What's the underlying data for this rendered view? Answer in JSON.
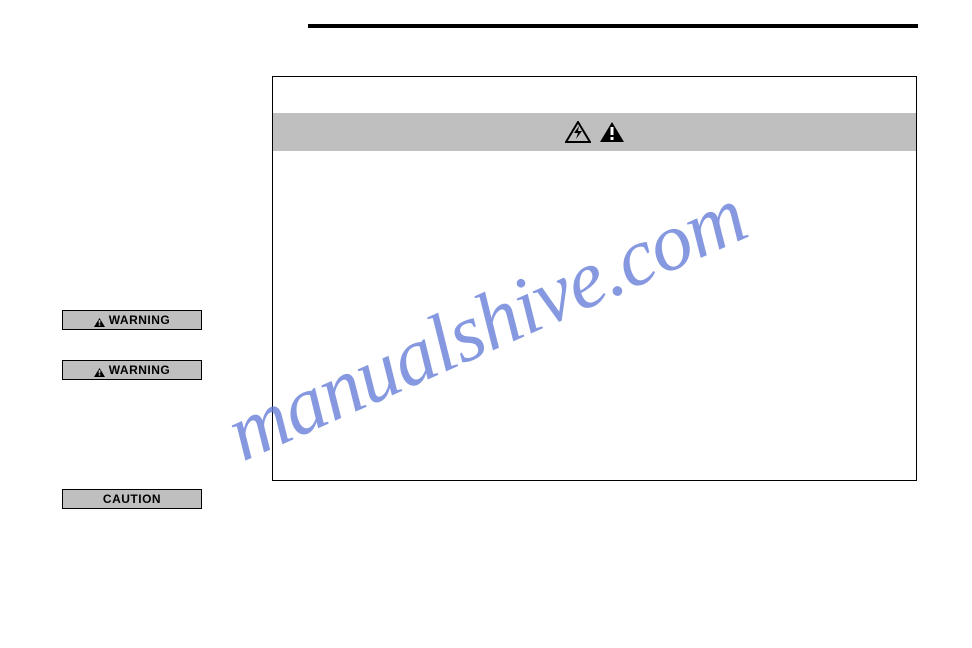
{
  "watermark": "manualshive.com",
  "sideLabels": {
    "warning1": "WARNING",
    "warning2": "WARNING",
    "caution": "CAUTION"
  },
  "icons": {
    "shock": "shock-triangle-icon",
    "alert": "alert-triangle-icon"
  }
}
